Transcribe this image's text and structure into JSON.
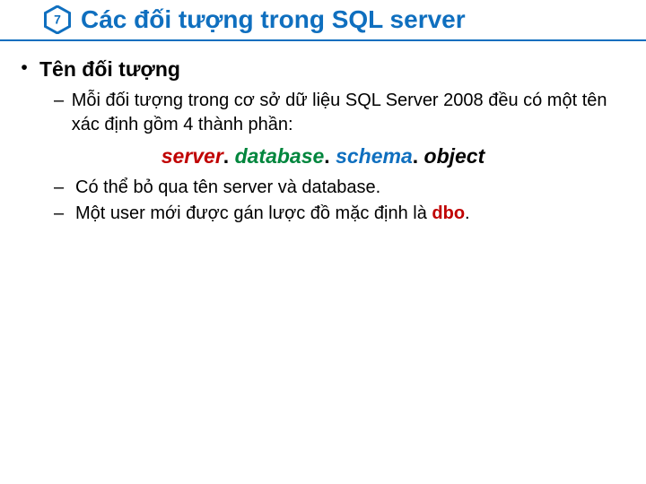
{
  "header": {
    "badge_number": "7",
    "title": "Các đối tượng trong SQL server"
  },
  "content": {
    "heading": "Tên đối tượng",
    "sub1": "Mỗi đối tượng trong cơ sở dữ liệu SQL Server 2008 đều có một tên xác định gồm 4 thành phần:",
    "naming": {
      "server": "server",
      "database": "database",
      "schema": "schema",
      "object": "object",
      "sep": ". "
    },
    "sub2": "Có thể bỏ qua tên server và database.",
    "sub3_pre": "Một user mới được gán lược đồ mặc định là ",
    "sub3_dbo": "dbo",
    "sub3_post": "."
  }
}
